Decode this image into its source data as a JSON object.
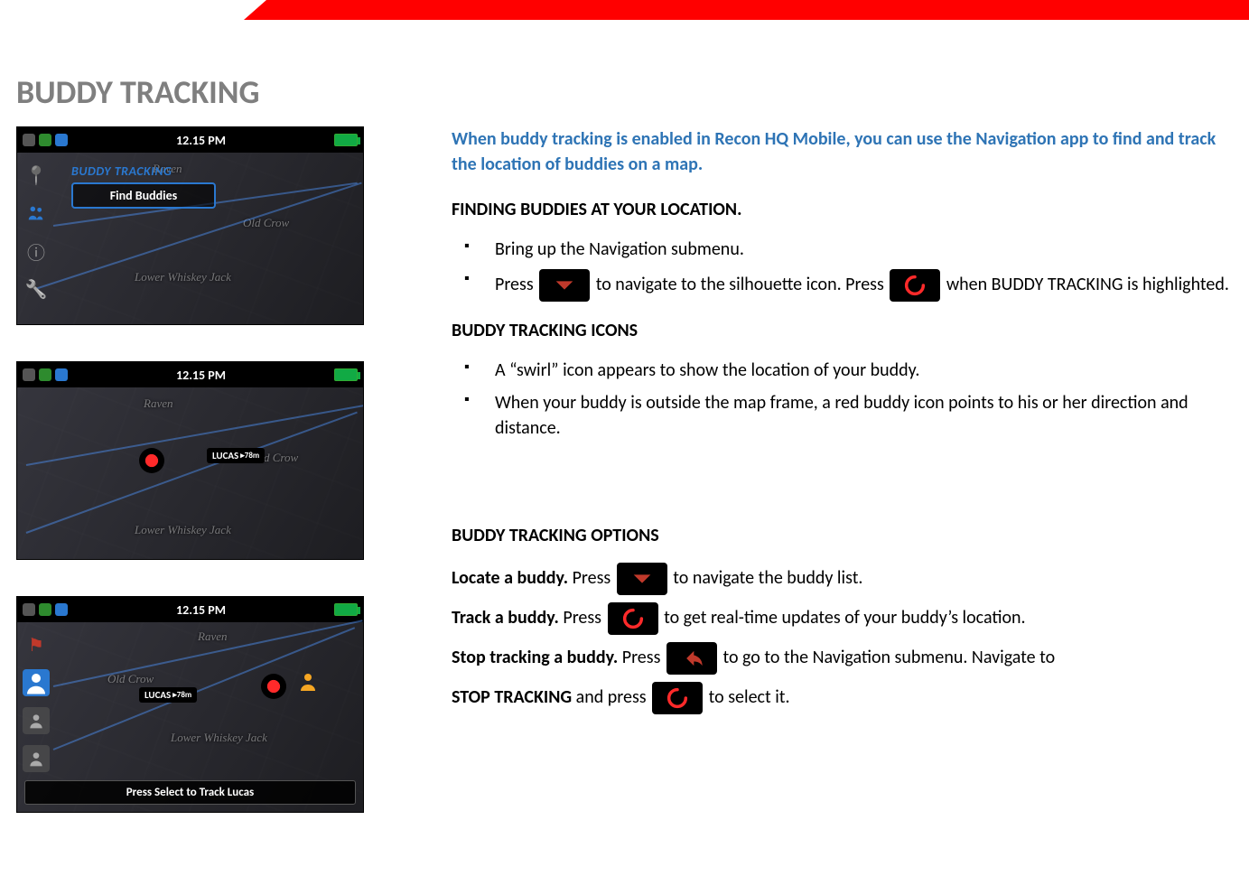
{
  "header": {
    "title": "BUDDY TRACKING"
  },
  "screenshots": {
    "time": "12.15 PM",
    "shot1": {
      "menu_title": "BUDDY TRACKING",
      "menu_item": "Find Buddies",
      "map_labels": [
        "Raven",
        "Old Crow",
        "Lower Whiskey Jack"
      ]
    },
    "shot2": {
      "tag": "LUCAS",
      "tag_dist": "▸78m",
      "map_labels": [
        "Raven",
        "Old Crow",
        "Lower Whiskey Jack"
      ]
    },
    "shot3": {
      "tag": "LUCAS",
      "tag_dist": "▸78m",
      "banner": "Press Select to Track Lucas",
      "map_labels": [
        "Raven",
        "Old Crow",
        "Lower Whiskey Jack"
      ]
    }
  },
  "body": {
    "intro": "When buddy tracking is enabled in Recon HQ Mobile, you can use the Navigation app to find and track the location of buddies on a map.",
    "s1_h": "FINDING BUDDIES AT YOUR LOCATION.",
    "s1_b1": "Bring up the Navigation submenu.",
    "s1_b2a": "Press ",
    "s1_b2b": " to navigate to the silhouette icon. Press ",
    "s1_b2c": " when BUDDY TRACKING is highlighted.",
    "s2_h": "BUDDY TRACKING ICONS",
    "s2_b1": "A “swirl” icon appears to show the location of your buddy.",
    "s2_b2": "When your buddy is outside the map frame, a red buddy icon points to his or her direction and distance.",
    "s3_h": "BUDDY TRACKING OPTIONS",
    "opt1a": "Locate a buddy.",
    "opt1b": " Press ",
    "opt1c": " to navigate the buddy list.",
    "opt2a": "Track a buddy.",
    "opt2b": " Press ",
    "opt2c": " to get real-time updates of your buddy’s location.",
    "opt3a": "Stop tracking a buddy.",
    "opt3b": " Press ",
    "opt3c": " to go to the Navigation submenu. Navigate to ",
    "opt4a": "STOP TRACKING",
    "opt4b": " and press ",
    "opt4c": " to select it."
  }
}
